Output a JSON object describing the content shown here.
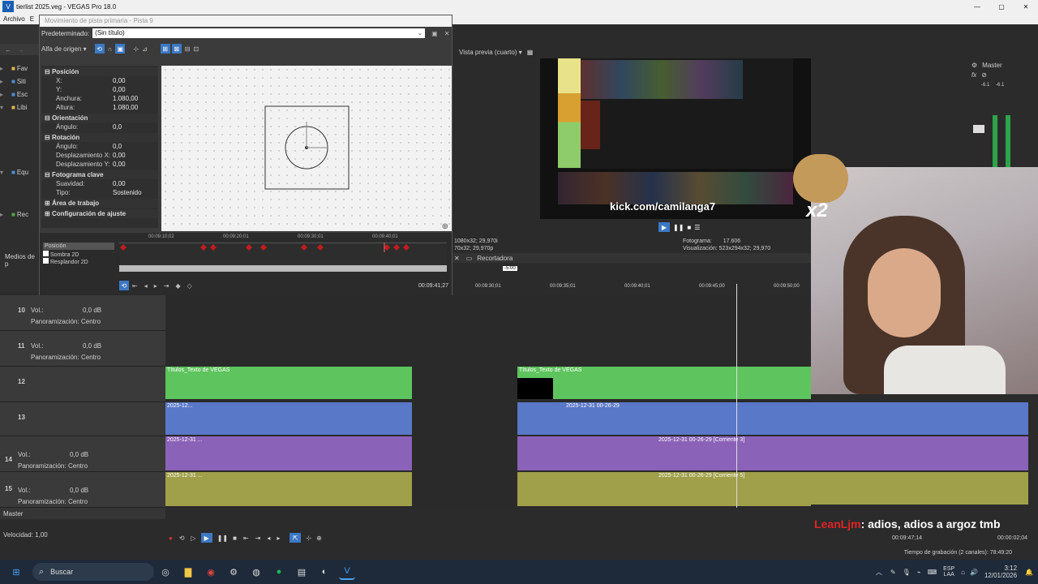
{
  "window": {
    "title": "tierlist 2025.veg - VEGAS Pro 18.0"
  },
  "menu": [
    "Archivo",
    "E"
  ],
  "dialog": {
    "title": "Movimiento de pista primaria - Pista 9",
    "preset_label": "Predeterminado:",
    "preset_value": "(Sin título)",
    "source_label": "Alfa de origen",
    "sections": [
      {
        "name": "Posición",
        "rows": [
          [
            "X:",
            "0,00"
          ],
          [
            "Y:",
            "0,00"
          ],
          [
            "Anchura:",
            "1.080,00"
          ],
          [
            "Altura:",
            "1.080,00"
          ]
        ]
      },
      {
        "name": "Orientación",
        "rows": [
          [
            "Ángulo:",
            "0,0"
          ]
        ]
      },
      {
        "name": "Rotación",
        "rows": [
          [
            "Ángulo:",
            "0,0"
          ],
          [
            "Desplazamiento X:",
            "0,00"
          ],
          [
            "Desplazamiento Y:",
            "0,00"
          ]
        ]
      },
      {
        "name": "Fotograma clave",
        "rows": [
          [
            "Suavidad:",
            "0,00"
          ],
          [
            "Tipo:",
            "Sostenido"
          ]
        ]
      },
      {
        "name": "Área de trabajo",
        "rows": []
      },
      {
        "name": "Configuración de ajuste",
        "rows": []
      }
    ],
    "kf_tracks": [
      "Posición",
      "Sombra 2D",
      "Resplandor 2D"
    ],
    "ruler": [
      "00:09:10;02",
      "00:09:20;01",
      "00:09:30;01",
      "00:09:40;01"
    ],
    "time": "00:09:41;27"
  },
  "left_panel": {
    "explorer_items": [
      "Fav",
      "Siti",
      "Esc",
      "Libi",
      "Equ",
      "Rec"
    ],
    "media_label": "Medios de p"
  },
  "preview": {
    "label": "Vista previa (cuarto)",
    "fotograma_label": "Fotograma:",
    "fotograma": "17.606",
    "vis_label": "Visualización:",
    "vis": "523x294x32; 29,970",
    "props_left": "1080x32; 29,970i",
    "props_left2": "70x32; 29,970p",
    "tab": "Recortadora",
    "stream_url": "kick.com/camilanga7",
    "multiplier": "x2"
  },
  "master": {
    "title": "Master",
    "db_l": "-6.1",
    "db_r": "-6.1"
  },
  "timeline": {
    "ruler": [
      "00:09:30;01",
      "00:09:35;01",
      "00:09:40;01",
      "00:09:45;00",
      "00:09:50;00"
    ],
    "small_marker": "-5:00",
    "tracks": [
      {
        "num": "10",
        "vol": "Vol.:",
        "vol_val": "0,0 dB",
        "pan": "Panoramización:",
        "pan_val": "Centro"
      },
      {
        "num": "11",
        "vol": "Vol.:",
        "vol_val": "0,0 dB",
        "pan": "Panoramización:",
        "pan_val": "Centro"
      },
      {
        "num": "12"
      },
      {
        "num": "13"
      },
      {
        "num": "14",
        "vol": "Vol.:",
        "vol_val": "0,0 dB",
        "pan": "Panoramización:",
        "pan_val": "Centro"
      },
      {
        "num": "15",
        "vol": "Vol.:",
        "vol_val": "0,0 dB",
        "pan": "Panoramización:",
        "pan_val": "Centro"
      }
    ],
    "meter_ticks": [
      "12",
      "24",
      "36",
      "48"
    ],
    "text_clip": "Títulos_Texto de VEGAS",
    "video_clips": [
      "2025-12...",
      "2025-12...",
      "2025-12-31 0...",
      "2...",
      "2025-12-31 00-26-29",
      "2025-12-31 00-26-29"
    ],
    "audio_clips_a": [
      "2025-12-31 ...",
      "2025-12-31 0...",
      "2025-12-31 00-2...",
      "2...",
      "202...",
      "2025-12-31 00-26-29 [...",
      "2025-12-31 00-26-29 [Corriente 3]"
    ],
    "audio_clips_b": [
      "2025-12-31 ...",
      "2025-12-31 0...",
      "2025-12-31 00-2...",
      "2...",
      "202...",
      "2025-12-31 00-26-29 [...",
      "2025-12-31 00-26-29 [Corriente 5]"
    ],
    "master_label": "Master",
    "speed": "Velocidad: 1,00",
    "cursor_time": "00:09:47;14",
    "rec_time": "00:00:02;04",
    "rec_status": "Tiempo de grabación (2 canales): 78:49:20"
  },
  "chat": {
    "user": "LeanLjm",
    "message": ": adios, adios a argoz tmb"
  },
  "taskbar": {
    "search": "Buscar",
    "lang1": "ESP",
    "lang2": "LAA",
    "time": "3:12",
    "date": "12/01/2026"
  }
}
